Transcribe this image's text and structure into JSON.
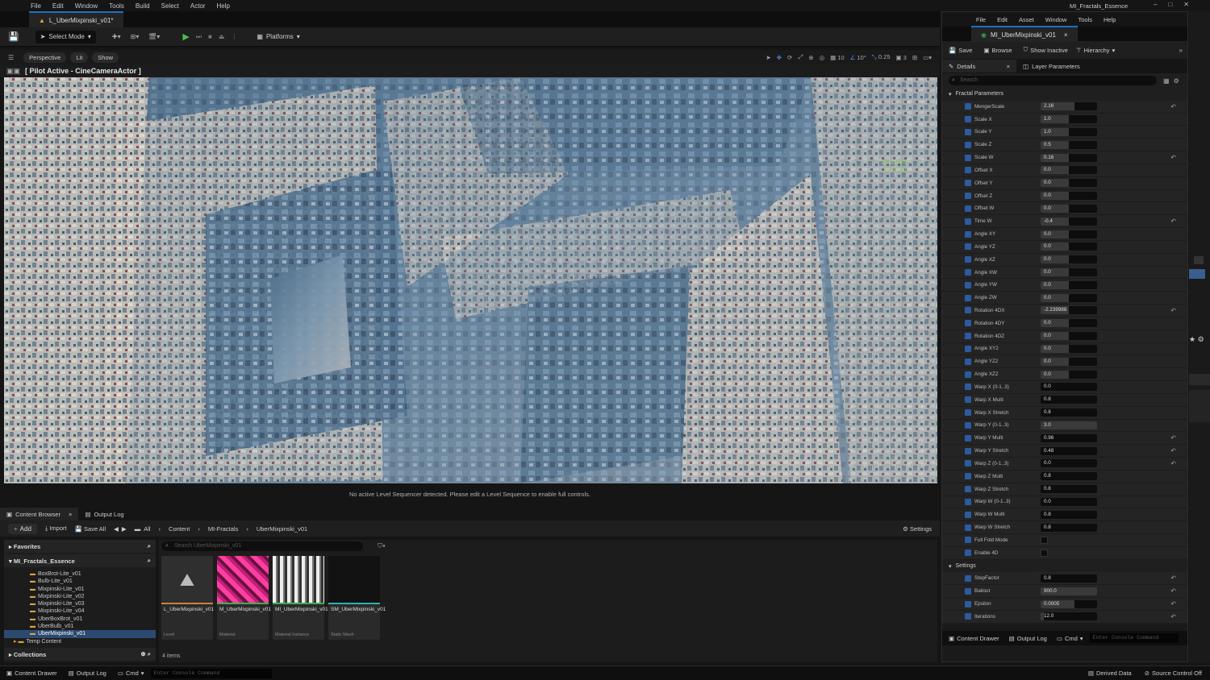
{
  "menu": [
    "File",
    "Edit",
    "Window",
    "Tools",
    "Build",
    "Select",
    "Actor",
    "Help"
  ],
  "level_tab": "L_UberMixpinski_v01*",
  "toolbar": {
    "select_mode": "Select Mode",
    "platforms": "Platforms"
  },
  "viewport_bar": {
    "perspective": "Perspective",
    "lit": "Lit",
    "show": "Show",
    "grid": "10",
    "rot": "10°",
    "scale": "0.25",
    "cam": "3"
  },
  "pilot": "[ Pilot Active - CineCameraActor ]",
  "fps": {
    "fps": "35.90 FPS",
    "ms": "27.80 ms"
  },
  "viewport_msg": "No active Level Sequencer detected. Please edit a Level Sequence to enable full controls.",
  "cb_tabs": {
    "content_browser": "Content Browser",
    "output_log": "Output Log"
  },
  "cb_toolbar": {
    "add": "Add",
    "import": "Import",
    "save_all": "Save All",
    "settings": "Settings"
  },
  "breadcrumb": [
    "All",
    "Content",
    "MI-Fractals",
    "UberMixpinski_v01"
  ],
  "left": {
    "favorites": "Favorites",
    "root": "MI_Fractals_Essence",
    "folders": [
      "BoxBrot-Lite_v01",
      "Bulb-Lite_v01",
      "Mixpinski-Lite_v01",
      "Mixpinski-Lite_v02",
      "Mixpinski-Lite_v03",
      "Mixpinski-Lite_v04",
      "UberBoxBrot_v01",
      "UberBulb_v01",
      "UberMixpinski_v01",
      "Temp Content"
    ],
    "collections": "Collections"
  },
  "search_placeholder": "Search UberMixpinski_v01",
  "assets": [
    {
      "name": "L_UberMixpinski_v01",
      "type": "Level"
    },
    {
      "name": "M_UberMixpinski_v01",
      "type": "Material"
    },
    {
      "name": "MI_UberMixpinski_v01",
      "type": "Material Instance"
    },
    {
      "name": "SM_UberMixpinski_v01",
      "type": "Static Mesh"
    }
  ],
  "item_count": "4 items",
  "status": {
    "content_drawer": "Content Drawer",
    "output_log": "Output Log",
    "cmd": "Cmd",
    "console": "Enter Console Command",
    "derived": "Derived Data",
    "source": "Source Control Off"
  },
  "rw": {
    "title": "MI_Fractals_Essence",
    "menu": [
      "File",
      "Edit",
      "Asset",
      "Window",
      "Tools",
      "Help"
    ],
    "tab": "MI_UberMixpinski_v01",
    "tool": {
      "save": "Save",
      "browse": "Browse",
      "show_inactive": "Show Inactive",
      "hierarchy": "Hierarchy"
    },
    "details": "Details",
    "layer": "Layer Parameters",
    "search": "Search",
    "cat1": "Fractal Parameters",
    "cat2": "Settings",
    "params": [
      {
        "n": "MengerScale",
        "v": "2.16",
        "f": 0.6,
        "r": true
      },
      {
        "n": "Scale X",
        "v": "1.0",
        "f": 0.5
      },
      {
        "n": "Scale Y",
        "v": "1.0",
        "f": 0.5
      },
      {
        "n": "Scale Z",
        "v": "0.5",
        "f": 0.5
      },
      {
        "n": "Scale W",
        "v": "0.16",
        "f": 0.5,
        "r": true
      },
      {
        "n": "Offset X",
        "v": "0.0",
        "f": 0.5
      },
      {
        "n": "Offset Y",
        "v": "0.0",
        "f": 0.5
      },
      {
        "n": "Offset Z",
        "v": "0.0",
        "f": 0.5
      },
      {
        "n": "Offset W",
        "v": "0.0",
        "f": 0.5
      },
      {
        "n": "Time W",
        "v": "-0.4",
        "f": 0.5,
        "r": true
      },
      {
        "n": "Angle XY",
        "v": "0.0",
        "f": 0.5
      },
      {
        "n": "Angle YZ",
        "v": "0.0",
        "f": 0.5
      },
      {
        "n": "Angle XZ",
        "v": "0.0",
        "f": 0.5
      },
      {
        "n": "Angle XW",
        "v": "0.0",
        "f": 0.5
      },
      {
        "n": "Angle YW",
        "v": "0.0",
        "f": 0.5
      },
      {
        "n": "Angle ZW",
        "v": "0.0",
        "f": 0.5
      },
      {
        "n": "Rotation 4DX",
        "v": "-2.239988",
        "f": 0.5,
        "r": true
      },
      {
        "n": "Rotation 4DY",
        "v": "0.0",
        "f": 0.5
      },
      {
        "n": "Rotation 4DZ",
        "v": "0.0",
        "f": 0.5
      },
      {
        "n": "Angle XY2",
        "v": "0.0",
        "f": 0.5
      },
      {
        "n": "Angle YZ2",
        "v": "0.0",
        "f": 0.5
      },
      {
        "n": "Angle XZ2",
        "v": "0.0",
        "f": 0.5
      },
      {
        "n": "Warp X (0-1..3)",
        "v": "0.0",
        "f": 0.0
      },
      {
        "n": "Warp X Multi",
        "v": "0.8",
        "f": 0.0
      },
      {
        "n": "Warp X Stretch",
        "v": "0.8",
        "f": 0.0
      },
      {
        "n": "Warp Y (0-1..3)",
        "v": "3.0",
        "f": 1.0
      },
      {
        "n": "Warp Y Multi",
        "v": "0.96",
        "f": 0.0,
        "r": true
      },
      {
        "n": "Warp Y Stretch",
        "v": "0.48",
        "f": 0.0,
        "r": true
      },
      {
        "n": "Warp Z (0-1..3)",
        "v": "0.0",
        "f": 0.0,
        "r": true
      },
      {
        "n": "Warp Z Multi",
        "v": "0.8",
        "f": 0.0
      },
      {
        "n": "Warp Z Stretch",
        "v": "0.8",
        "f": 0.0
      },
      {
        "n": "Warp W (0-1..3)",
        "v": "0.0",
        "f": 0.0
      },
      {
        "n": "Warp W Multi",
        "v": "0.8",
        "f": 0.0
      },
      {
        "n": "Warp W Stretch",
        "v": "0.8",
        "f": 0.0
      },
      {
        "n": "Full Fold Mode",
        "check": true
      },
      {
        "n": "Enable 4D",
        "check": true
      }
    ],
    "settings": [
      {
        "n": "StepFactor",
        "v": "0.8",
        "f": 0.0,
        "r": true
      },
      {
        "n": "Bailout",
        "v": "900.0",
        "f": 1.0,
        "r": true
      },
      {
        "n": "Epsilon",
        "v": "0.0005",
        "f": 0.6,
        "r": true
      },
      {
        "n": "Iterations",
        "v": "12.0",
        "f": 0.05,
        "r": true
      }
    ],
    "bottom": {
      "content_drawer": "Content Drawer",
      "output_log": "Output Log",
      "cmd": "Cmd",
      "console": "Enter Console Command"
    }
  }
}
